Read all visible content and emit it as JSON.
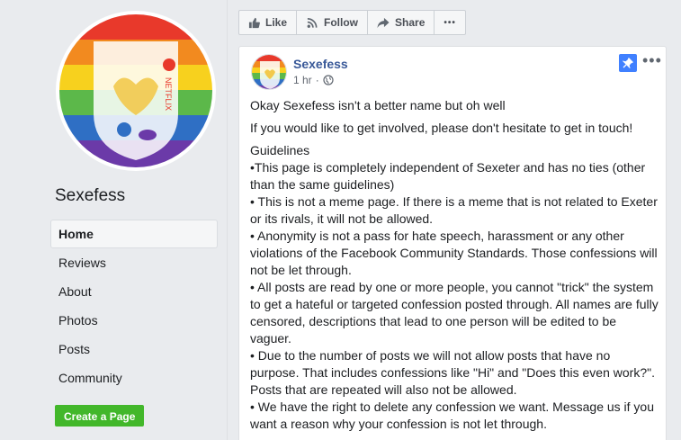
{
  "page": {
    "name": "Sexefess",
    "logo_text": "NETFLIX"
  },
  "sidebar": {
    "items": [
      {
        "label": "Home",
        "active": true
      },
      {
        "label": "Reviews"
      },
      {
        "label": "About"
      },
      {
        "label": "Photos"
      },
      {
        "label": "Posts"
      },
      {
        "label": "Community"
      }
    ],
    "create_label": "Create a Page"
  },
  "actionbar": {
    "like": "Like",
    "follow": "Follow",
    "share": "Share",
    "more": "•••"
  },
  "post": {
    "author": "Sexefess",
    "time": "1 hr",
    "separator": "·",
    "more": "•••",
    "para1": "Okay Sexefess isn't a better name but oh well",
    "para2": "If you would like to get involved, please don't hesitate to get in touch!",
    "guidelines_title": "Guidelines",
    "guidelines": [
      "•This page is completely independent of Sexeter and has no ties (other than the same guidelines)",
      "• This is not a meme page. If there is a meme that is not related to Exeter or its rivals, it will not be allowed.",
      "• Anonymity is not a pass for hate speech, harassment or any other violations of the Facebook Community Standards. Those confessions will not be let through.",
      "• All posts are read by one or more people, you cannot \"trick\" the system to get a hateful or targeted confession posted through. All names are fully censored, descriptions that lead to one person will be edited to be vaguer.",
      "• Due to the number of posts we will not allow posts that have no purpose. That includes confessions like \"Hi\" and \"Does this even work?\". Posts that are repeated will also not be allowed.",
      "• We have the right to delete any confession we want. Message us if you want a reason why your confession is not let through."
    ]
  },
  "colors": {
    "link": "#385898",
    "green": "#42b72a",
    "pin": "#4080ff"
  }
}
